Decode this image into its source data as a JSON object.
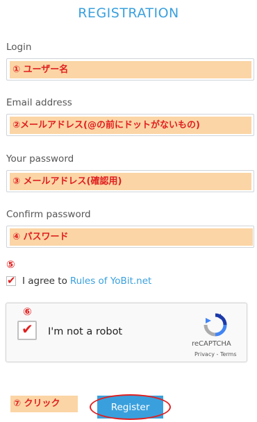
{
  "page": {
    "title": "REGISTRATION"
  },
  "form": {
    "login": {
      "label": "Login",
      "note": "① ユーザー名"
    },
    "email": {
      "label": "Email address",
      "note": "②メールアドレス(@の前にドットがないもの)"
    },
    "password": {
      "label": "Your password",
      "note": "③ メールアドレス(確認用)"
    },
    "confirm": {
      "label": "Confirm password",
      "note": "④ パスワード"
    },
    "agree": {
      "marker": "⑤",
      "text": "I agree to",
      "link": "Rules of YoBit.net",
      "check": "✔"
    }
  },
  "recaptcha": {
    "marker": "⑥",
    "check": "✔",
    "label": "I'm not a robot",
    "brand": "reCAPTCHA",
    "terms": "Privacy - Terms"
  },
  "register": {
    "marker_note": "⑦ クリック",
    "button_label": "Register"
  },
  "colors": {
    "accent": "#3aa0dd",
    "annotation": "#e02020",
    "highlight": "#fbd5a5"
  }
}
